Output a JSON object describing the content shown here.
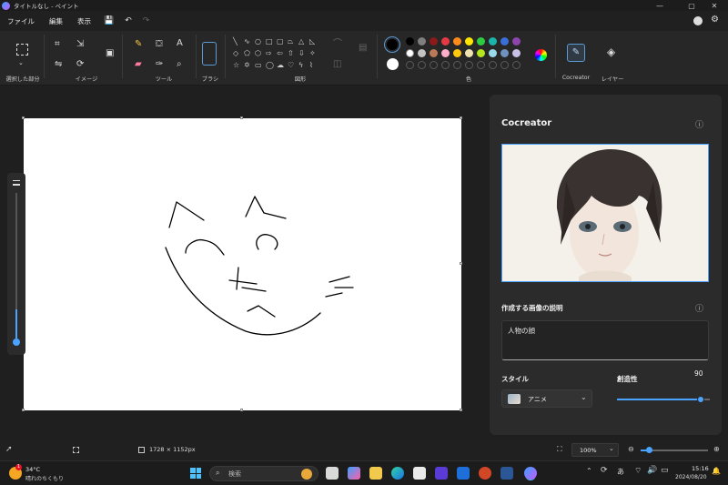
{
  "window": {
    "title": "タイトルなし - ペイント",
    "min": "—",
    "max": "▢",
    "close": "✕"
  },
  "menu": {
    "file": "ファイル",
    "edit": "編集",
    "view": "表示"
  },
  "toolbar": {
    "groups": {
      "selection": "選択した部分",
      "image": "イメージ",
      "tools": "ツール",
      "brush": "ブラシ",
      "shapes": "図形",
      "colors": "色",
      "cocreator": "Cocreator",
      "layers": "レイヤー"
    },
    "tools": {
      "text": "A"
    },
    "primary_color": "#000000",
    "secondary_color": "#ffffff",
    "palette_row1": [
      "#000000",
      "#7f7f7f",
      "#8b1a1a",
      "#e63946",
      "#ff8c1a",
      "#ffe600",
      "#2ecc40",
      "#1ab5a8",
      "#3a6fd8",
      "#8e44ad"
    ],
    "palette_row2": [
      "#ffffff",
      "#c3c3c3",
      "#b97a57",
      "#ffaec9",
      "#ffc90e",
      "#efe4b0",
      "#b5e61d",
      "#99d9ea",
      "#7092be",
      "#c8bfe7"
    ]
  },
  "canvas": {
    "background": "#ffffff",
    "stroke": "#000000"
  },
  "cocreator": {
    "title": "Cocreator",
    "info_icon": "ⓘ",
    "description_label": "作成する画像の説明",
    "prompt_value": "人物の顔",
    "style_label": "スタイル",
    "style_value": "アニメ",
    "creativity_label": "創造性",
    "creativity_value": "90",
    "creativity_fraction": 0.9
  },
  "status": {
    "dimensions": "1728 × 1152px",
    "zoom": "100%"
  },
  "taskbar": {
    "weather_temp": "34°C",
    "weather_desc": "晴れのちくもり",
    "weather_badge": "1",
    "search_placeholder": "検索",
    "time": "15:16",
    "date": "2024/08/20",
    "ime": "あ"
  }
}
